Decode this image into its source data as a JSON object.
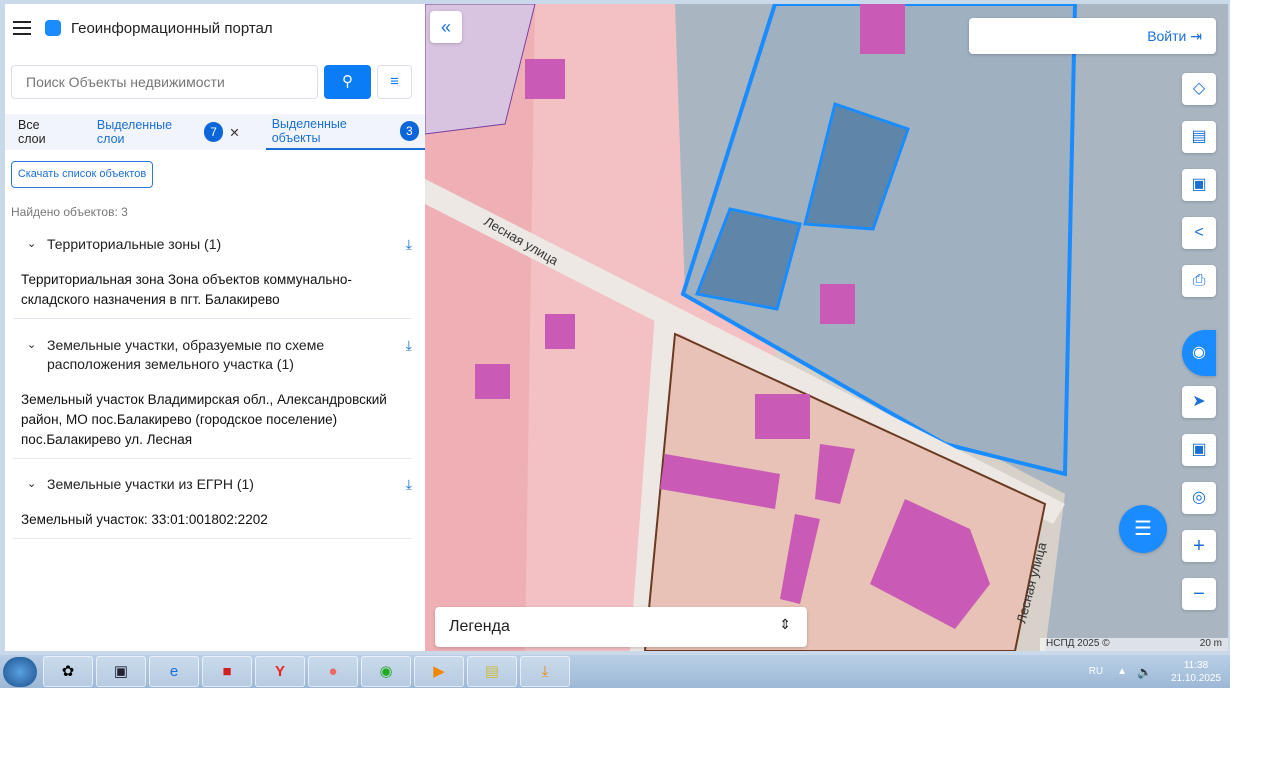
{
  "header": {
    "title": "Геоинформационный портал"
  },
  "search": {
    "placeholder": "Поиск Объекты недвижимости"
  },
  "tabs": [
    {
      "label": "Все слои"
    },
    {
      "label": "Выделенные слои",
      "count": "7"
    },
    {
      "label": "Выделенные объекты",
      "count": "3"
    }
  ],
  "download_list_label": "Скачать список объектов",
  "found_label": "Найдено объектов: 3",
  "groups": [
    {
      "title": "Территориальные зоны (1)",
      "items": [
        "Территориальная зона Зона объектов коммунально-складского назначения в пгт. Балакирево"
      ]
    },
    {
      "title": "Земельные участки, образуемые по схеме расположения земельного участка (1)",
      "items": [
        "Земельный участок Владимирская обл., Александровский район, МО пос.Балакирево (городское поселение) пос.Балакирево ул. Лесная"
      ]
    },
    {
      "title": "Земельные участки из ЕГРН (1)",
      "items": [
        "Земельный участок: 33:01:001802:2202"
      ]
    }
  ],
  "map": {
    "login_label": "Войти",
    "legend_label": "Легенда",
    "street1": "Лесная улица",
    "street2": "Лесная улица",
    "attribution": "НСПД 2025 ©",
    "scale": "20 m",
    "tools": [
      "layers-icon",
      "ruler-icon",
      "select-area-icon",
      "share-icon",
      "print-icon",
      "pkk-icon",
      "locate-icon",
      "minimap-icon",
      "geo-search-icon",
      "zoom-in-icon",
      "zoom-out-icon"
    ]
  },
  "taskbar": {
    "lang": "RU",
    "time": "11:38",
    "date": "21.10.2025"
  },
  "colors": {
    "accent": "#0a7cf5",
    "selection": "#1a8cff",
    "zone": "#f2b8bc",
    "building": "#c95ab5"
  }
}
